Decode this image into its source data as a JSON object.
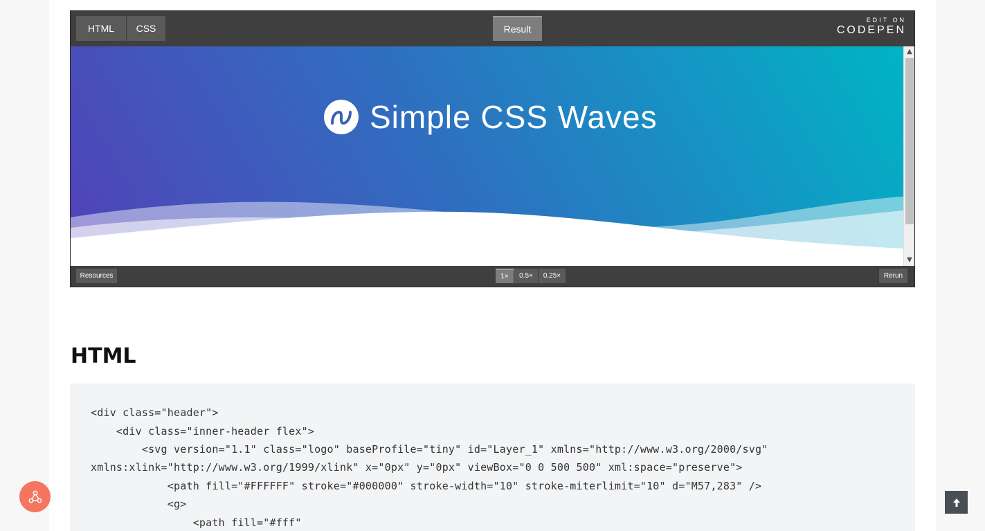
{
  "embed": {
    "tabs": [
      {
        "label": "HTML"
      },
      {
        "label": "CSS"
      }
    ],
    "result_tab": "Result",
    "edit_on": "EDIT ON",
    "brand": "CODEPEN",
    "hero_title": "Simple CSS Waves",
    "resources_label": "Resources",
    "zoom_options": [
      "1×",
      "0.5×",
      "0.25×"
    ],
    "zoom_selected": "1×",
    "rerun_label": "Rerun"
  },
  "section": {
    "title": "HTML"
  },
  "code": {
    "lines": [
      "<div class=\"header\">",
      "    <div class=\"inner-header flex\">",
      "        <svg version=\"1.1\" class=\"logo\" baseProfile=\"tiny\" id=\"Layer_1\" xmlns=\"http://www.w3.org/2000/svg\"",
      "xmlns:xlink=\"http://www.w3.org/1999/xlink\" x=\"0px\" y=\"0px\" viewBox=\"0 0 500 500\" xml:space=\"preserve\">",
      "            <path fill=\"#FFFFFF\" stroke=\"#000000\" stroke-width=\"10\" stroke-miterlimit=\"10\" d=\"M57,283\" />",
      "            <g>",
      "                <path fill=\"#fff\""
    ]
  },
  "colors": {
    "accent_fab": "#f47560",
    "hero_gradient_start": "#5341b8",
    "hero_gradient_end": "#00b4c6"
  },
  "icons": {
    "left_fab": "share-nodes-icon",
    "right_fab": "arrow-up-icon",
    "logo": "wave-logo-icon"
  }
}
